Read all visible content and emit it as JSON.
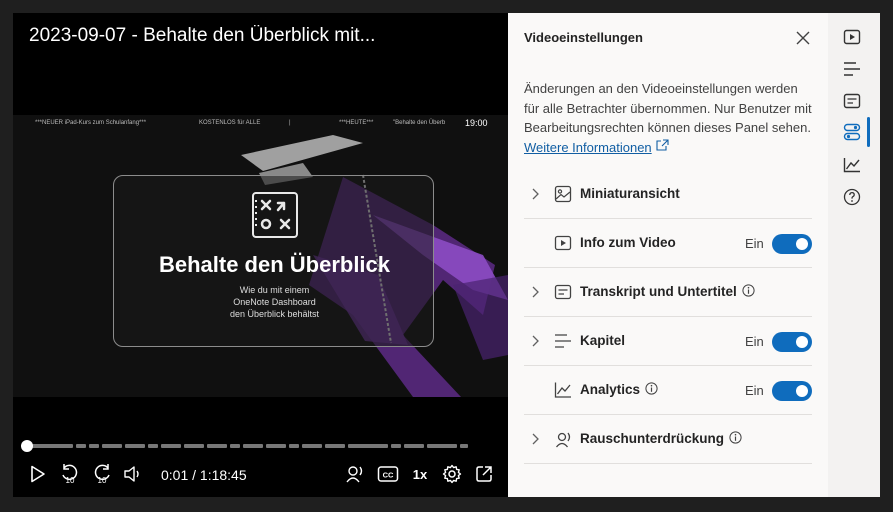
{
  "video": {
    "title": "2023-09-07 - Behalte den Überblick mit...",
    "ticker": {
      "item1": "***NEUER iPad-Kurs zum Schulanfang***",
      "item2": "KOSTENLOS für ALLE",
      "item3": "***HEUTE***",
      "item4": "\"Behalte den Überb",
      "clock": "19:00"
    },
    "slide": {
      "title": "Behalte den Überblick",
      "subtitle": [
        "Wie du mit einem",
        "OneNote Dashboard",
        "den Überblick behältst"
      ]
    },
    "time": "0:01 / 1:18:45",
    "progress_fraction": 0.0,
    "speed": "1x",
    "rewind_seconds": "10",
    "forward_seconds": "10",
    "accent": "#ffffff"
  },
  "panel": {
    "title": "Videoeinstellungen",
    "description": "Änderungen an den Videoeinstellungen werden für alle Betrachter übernommen. Nur Benutzer mit Bearbeitungsrechten können dieses Panel sehen.",
    "link": "Weitere Informationen",
    "rows": [
      {
        "label": "Miniaturansicht",
        "icon": "image-icon",
        "expandable": true,
        "info": false,
        "state": "",
        "toggle": false
      },
      {
        "label": "Info zum Video",
        "icon": "play-box-icon",
        "expandable": false,
        "info": false,
        "state": "Ein",
        "toggle": true
      },
      {
        "label": "Transkript und Untertitel",
        "icon": "transcript-icon",
        "expandable": true,
        "info": true,
        "state": "",
        "toggle": false
      },
      {
        "label": "Kapitel",
        "icon": "chapters-icon",
        "expandable": true,
        "info": false,
        "state": "Ein",
        "toggle": true
      },
      {
        "label": "Analytics",
        "icon": "analytics-icon",
        "expandable": false,
        "info": true,
        "state": "Ein",
        "toggle": true
      },
      {
        "label": "Rauschunterdrückung",
        "icon": "noise-icon",
        "expandable": true,
        "info": true,
        "state": "",
        "toggle": false
      }
    ],
    "toggle_color": "#0f6cbd"
  },
  "rail": {
    "items": [
      "video-icon",
      "chapters-icon",
      "transcript-icon",
      "settings-toggles-icon",
      "analytics-icon",
      "help-icon"
    ],
    "active": "settings-toggles-icon"
  }
}
